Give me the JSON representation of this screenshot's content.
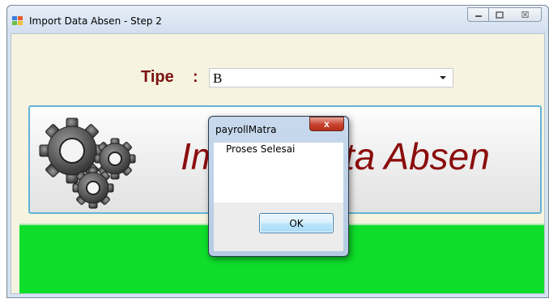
{
  "window": {
    "title": "Import Data Absen - Step 2",
    "caption_buttons": {
      "minimize_icon": "minimize-icon",
      "maximize_icon": "maximize-icon",
      "close_icon": "close-icon",
      "close_glyph": "☒"
    }
  },
  "form": {
    "tipe_label": "Tipe",
    "tipe_colon": ":",
    "tipe_value": "B",
    "banner_title": "Import Data Absen",
    "banner_icon": "gears-icon"
  },
  "dialog": {
    "title": "payrollMatra",
    "close_glyph": "x",
    "message": "Proses Selesai",
    "ok_label": "OK"
  },
  "colors": {
    "title_red": "#8b0d0d",
    "label_red": "#7c1010",
    "green_panel": "#0ede2a",
    "banner_border": "#63b3d9",
    "client_bg": "#f6f4e0"
  }
}
